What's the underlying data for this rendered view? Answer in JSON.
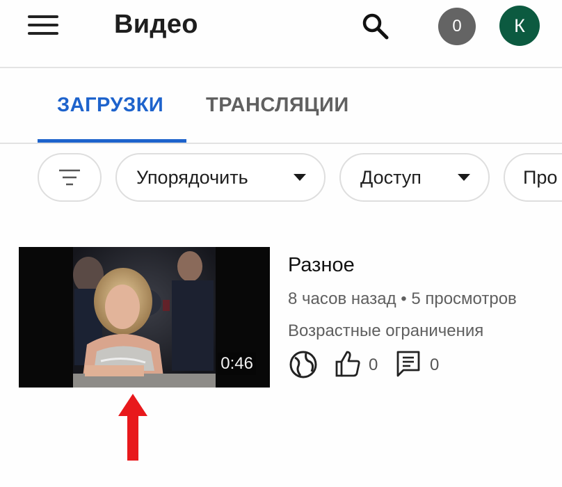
{
  "header": {
    "title": "Видео",
    "notification_count": "0",
    "avatar_letter": "К",
    "icons": [
      "menu-icon",
      "search-icon"
    ]
  },
  "tabs": [
    {
      "label": "ЗАГРУЗКИ",
      "active": true
    },
    {
      "label": "ТРАНСЛЯЦИИ",
      "active": false
    }
  ],
  "filters": {
    "filter_icon": "filter-icon",
    "sort_label": "Упорядочить",
    "access_label": "Доступ",
    "more_label": "Про"
  },
  "video": {
    "title": "Разное",
    "meta": "8 часов назад • 5 просмотров",
    "restriction": "Возрастные ограничения",
    "duration": "0:46",
    "likes": "0",
    "comments": "0",
    "visibility_icon": "globe-icon"
  },
  "colors": {
    "accent": "#1e63cc",
    "avatar_bg": "#0c5a40",
    "badge_bg": "#646464",
    "arrow": "#e8191c"
  }
}
